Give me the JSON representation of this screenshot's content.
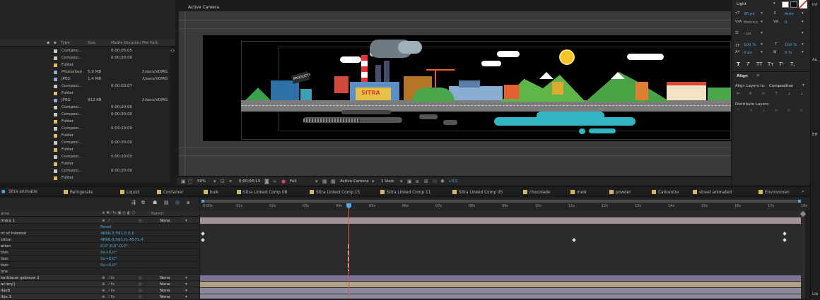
{
  "project": {
    "columns": [
      "Type",
      "Size",
      "Media Duration",
      "File Path"
    ],
    "items": [
      {
        "type": "Composi...",
        "size": "",
        "duration": "0:00:05:05",
        "path": "",
        "color": "#c7c7c7"
      },
      {
        "type": "Composi...",
        "size": "",
        "duration": "0:00:20:00",
        "path": "",
        "color": "#c7c7c7"
      },
      {
        "type": "Folder",
        "size": "",
        "duration": "",
        "path": "",
        "color": "#e0c05a"
      },
      {
        "type": "Photoshop",
        "size": "5,9 MB",
        "duration": "",
        "path": "/Users/VDMG",
        "color": "#8ea3e6"
      },
      {
        "type": "JPEG",
        "size": "1,4 MB",
        "duration": "",
        "path": "/Users/VDMG",
        "color": "#8ea3e6"
      },
      {
        "type": "Composi...",
        "size": "",
        "duration": "0:00:03:07",
        "path": "",
        "color": "#c7c7c7"
      },
      {
        "type": "Folder",
        "size": "",
        "duration": "",
        "path": "",
        "color": "#e0c05a"
      },
      {
        "type": "JPEG",
        "size": "912 KB",
        "duration": "",
        "path": "/Users/VDMG",
        "color": "#8ea3e6"
      },
      {
        "type": "Composi...",
        "size": "",
        "duration": "0:00:20:00",
        "path": "",
        "color": "#c7c7c7"
      },
      {
        "type": "Composi...",
        "size": "",
        "duration": "0:00:20:00",
        "path": "",
        "color": "#c7c7c7"
      },
      {
        "type": "Folder",
        "size": "",
        "duration": "",
        "path": "",
        "color": "#e0c05a"
      },
      {
        "type": "Composi...",
        "size": "",
        "duration": "0:03:10:00",
        "path": "",
        "color": "#c7c7c7"
      },
      {
        "type": "Folder",
        "size": "",
        "duration": "",
        "path": "",
        "color": "#e0c05a"
      },
      {
        "type": "Composi...",
        "size": "",
        "duration": "0:00:20:00",
        "path": "",
        "color": "#c7c7c7"
      },
      {
        "type": "Folder",
        "size": "",
        "duration": "",
        "path": "",
        "color": "#e0c05a"
      },
      {
        "type": "Composi...",
        "size": "",
        "duration": "0:00:20:00",
        "path": "",
        "color": "#c7c7c7"
      },
      {
        "type": "Folder",
        "size": "",
        "duration": "",
        "path": "",
        "color": "#e0c05a"
      },
      {
        "type": "Composi...",
        "size": "",
        "duration": "0:00:20:00",
        "path": "",
        "color": "#c7c7c7"
      },
      {
        "type": "Folder",
        "size": "",
        "duration": "",
        "path": "",
        "color": "#e0c05a"
      }
    ]
  },
  "viewer": {
    "title": "Active Camera",
    "billboard": "PRODUCTS",
    "truck_label": "SITRA"
  },
  "comp_toolbar": {
    "zoom": "50%",
    "timecode": "0;00;04;13",
    "resolution": "Full",
    "camera": "Active Camera",
    "views": "1 View",
    "exposure": "+0,0"
  },
  "character": {
    "font_style": "Light",
    "font_size": "36 px",
    "leading": "Auto",
    "kerning_label": "Metrics",
    "tracking": "0",
    "stroke_width": "- px",
    "vert_scale": "100 %",
    "horiz_scale": "100 %",
    "baseline_shift": "0 px",
    "tsume": "0 %",
    "type_buttons": [
      "T",
      "T",
      "TT",
      "Tт",
      "T¹",
      "T,"
    ]
  },
  "align": {
    "title": "Align",
    "align_layers_label": "Align Layers to:",
    "align_target": "Composition",
    "distribute_label": "Distribute Layers:"
  },
  "right_edge": {
    "labels": [
      "Inf",
      "Au",
      "Eff",
      "Lib"
    ]
  },
  "tabs": [
    "Sitra animatie",
    "Refrigerate",
    "Liquid",
    "Container",
    "bulk",
    "Sitra Linked Comp 08",
    "Sitra Linked Comp 15",
    "Sitra Linked Comp 11",
    "Sitra Linked Comp 05",
    "chocolade",
    "melk",
    "powder",
    "Callcentre",
    "street animated",
    "Environmen"
  ],
  "timeline": {
    "parent_header": "Parent",
    "name_header": "ame",
    "ruler": [
      "0:00s",
      "01s",
      "02s",
      "03s",
      "04s",
      "05s",
      "06s",
      "07s",
      "08s",
      "09s",
      "10s",
      "11s",
      "12s",
      "13s",
      "14s",
      "15s",
      "16s",
      "17s",
      "18s"
    ],
    "layers": [
      {
        "name": "mera 1",
        "value": "",
        "parent": "None",
        "kind": "layer"
      },
      {
        "name": "",
        "value": "Reset",
        "parent": "",
        "kind": "prop"
      },
      {
        "name": "nt of Interest",
        "value": "4666,0,591,0,0,0",
        "parent": "",
        "kind": "prop"
      },
      {
        "name": "sition",
        "value": "4666,0,591,0,-8571,4",
        "parent": "",
        "kind": "prop"
      },
      {
        "name": "ation",
        "value": "0,0°,0,0°,0,0°",
        "parent": "",
        "kind": "prop"
      },
      {
        "name": "tion",
        "value": "0x+0,0°",
        "parent": "",
        "kind": "prop"
      },
      {
        "name": "tion",
        "value": "0x+0,0°",
        "parent": "",
        "kind": "prop"
      },
      {
        "name": "tion",
        "value": "0x+0,0°",
        "parent": "",
        "kind": "prop"
      },
      {
        "name": "ons",
        "value": "",
        "parent": "",
        "kind": "prop"
      },
      {
        "name": "kerblauw gebouw 2",
        "value": "",
        "parent": "None",
        "kind": "layer"
      },
      {
        "name": "actory]",
        "value": "",
        "parent": "None",
        "kind": "layer"
      },
      {
        "name": "lkje8",
        "value": "",
        "parent": "None",
        "kind": "layer"
      },
      {
        "name": "lkje 3",
        "value": "",
        "parent": "None",
        "kind": "layer"
      }
    ],
    "playhead_time": "04s"
  }
}
